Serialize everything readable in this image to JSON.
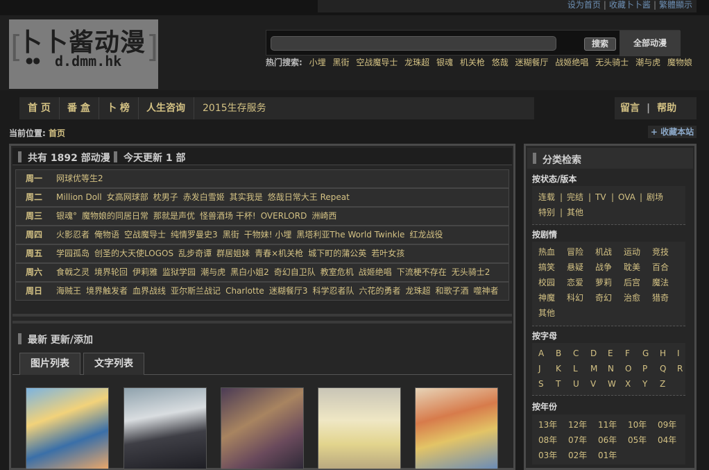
{
  "topbar": {
    "links": [
      "设为首页",
      "收藏卜卜酱",
      "繁體顯示"
    ]
  },
  "logo": {
    "title": "卜卜酱动漫",
    "domain": "d.dmm.hk"
  },
  "search": {
    "button": "搜索",
    "all_button": "全部动漫",
    "hot_label": "热门搜索:",
    "hot": [
      "小埋",
      "黑街",
      "空战魔导士",
      "龙珠超",
      "银魂",
      "机关枪",
      "悠哉",
      "迷糊餐厅",
      "战姬绝唱",
      "无头骑士",
      "潮与虎",
      "魔物娘"
    ]
  },
  "nav": {
    "items": [
      "首 页",
      "番 盒",
      "卜 榜",
      "人生咨询",
      "2015生存服务"
    ],
    "right": [
      "留言",
      "帮助"
    ]
  },
  "breadcrumb": {
    "label": "当前位置:",
    "value": "首页",
    "favorite": "+ 收藏本站"
  },
  "main": {
    "total": "共有 1892 部动漫",
    "today": "今天更新 1 部",
    "schedule": [
      {
        "day": "周一",
        "items": [
          "网球优等生2"
        ]
      },
      {
        "day": "周二",
        "items": [
          "Million Doll",
          "女高网球部",
          "枕男子",
          "赤发白雪姬",
          "其实我是",
          "悠哉日常大王 Repeat"
        ]
      },
      {
        "day": "周三",
        "items": [
          "银魂°",
          "魔物娘的同居日常",
          "那就是声优",
          "怪兽酒场 干杯!",
          "OVERLORD",
          "洲崎西"
        ]
      },
      {
        "day": "周四",
        "items": [
          "火影忍者",
          "俺物语",
          "空战魔导士",
          "纯情罗曼史3",
          "黑街",
          "干物妹! 小埋",
          "黑塔利亚The World Twinkle",
          "红龙战役"
        ]
      },
      {
        "day": "周五",
        "items": [
          "学园孤岛",
          "创圣的大天使LOGOS",
          "乱步奇谭",
          "群居姐妹",
          "青春×机关枪",
          "城下町的蒲公英",
          "若叶女孩"
        ]
      },
      {
        "day": "周六",
        "items": [
          "食戟之灵",
          "境界轮回",
          "伊莉雅",
          "监狱学园",
          "潮与虎",
          "黑白小姐2",
          "奇幻自卫队",
          "教室危机",
          "战姬绝唱",
          "下流梗不存在",
          "无头骑士2"
        ]
      },
      {
        "day": "周日",
        "items": [
          "海贼王",
          "境界触发者",
          "血界战线",
          "亚尔斯兰战记",
          "Charlotte",
          "迷糊餐厅3",
          "科学忍者队",
          "六花的勇者",
          "龙珠超",
          "和歌子酒",
          "噬神者"
        ]
      }
    ],
    "latest_title": "最新 更新/添加",
    "tabs": [
      "图片列表",
      "文字列表"
    ]
  },
  "sidebar": {
    "title": "分类检索",
    "status_title": "按状态/版本",
    "status": [
      "连载",
      "完结",
      "TV",
      "OVA",
      "剧场",
      "特别",
      "其他"
    ],
    "plot_title": "按剧情",
    "plot": [
      "热血",
      "冒险",
      "机战",
      "运动",
      "竞技",
      "搞笑",
      "悬疑",
      "战争",
      "耽美",
      "百合",
      "校园",
      "恋爱",
      "萝莉",
      "后宫",
      "魔法",
      "神魔",
      "科幻",
      "奇幻",
      "治愈",
      "猎奇",
      "其他"
    ],
    "letter_title": "按字母",
    "letters": [
      "A",
      "B",
      "C",
      "D",
      "E",
      "F",
      "G",
      "H",
      "I",
      "J",
      "K",
      "L",
      "M",
      "N",
      "O",
      "P",
      "Q",
      "R",
      "S",
      "T",
      "U",
      "V",
      "W",
      "X",
      "Y",
      "Z"
    ],
    "year_title": "按年份",
    "years": [
      "13年",
      "12年",
      "11年",
      "10年",
      "09年",
      "08年",
      "07年",
      "06年",
      "05年",
      "04年",
      "03年",
      "02年",
      "01年"
    ]
  },
  "colors": {
    "background": "#1b1b1b",
    "link": "#d4c284",
    "accent_blue": "#6e90b5"
  }
}
